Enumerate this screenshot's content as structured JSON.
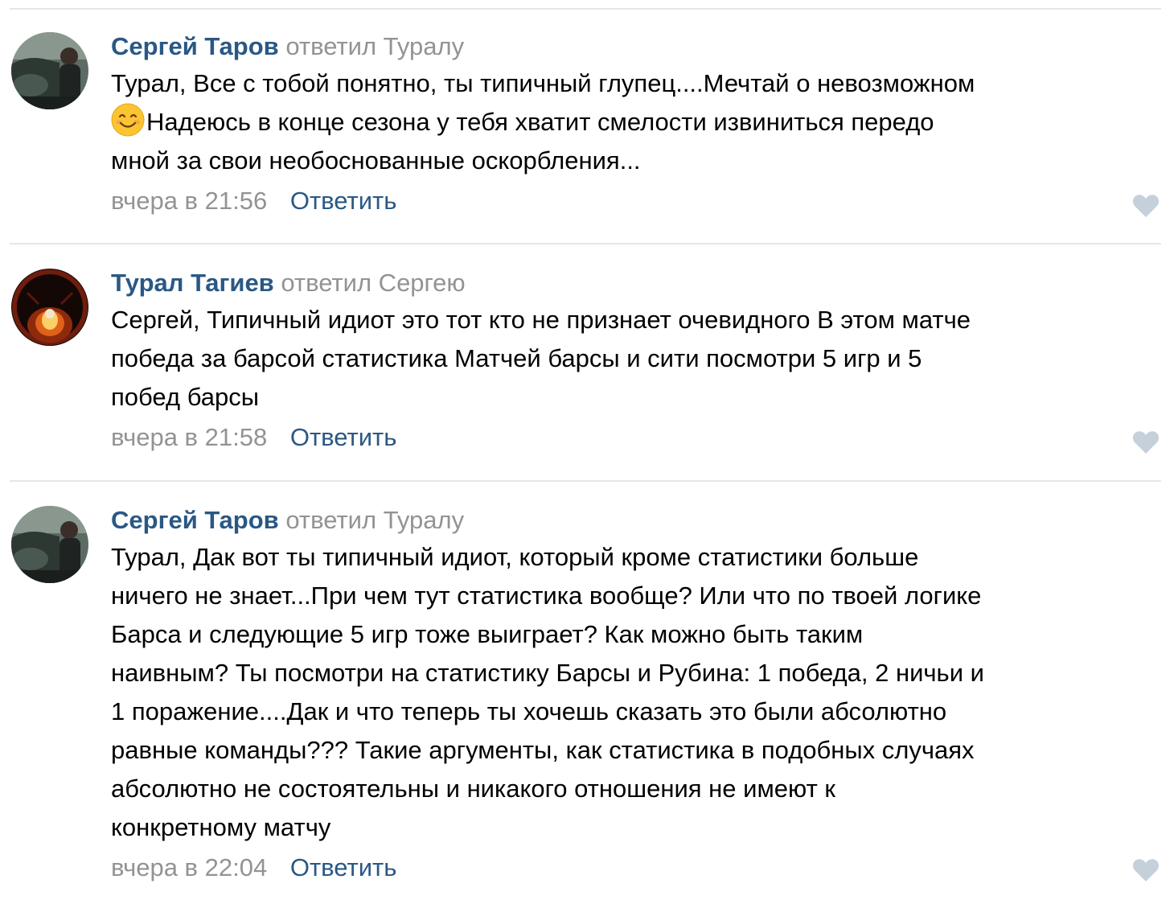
{
  "comments": [
    {
      "author": "Сергей Таров",
      "replied_to": "ответил Туралу",
      "text_lines": [
        "Турал, Все с тобой понятно, ты типичный глупец....Мечтай о невозможном",
        "Надеюсь в конце сезона у тебя хватит смелости извиниться передо",
        "мной за свои необоснованные оскорбления..."
      ],
      "time": "вчера в 21:56",
      "reply_label": "Ответить",
      "avatar_icon": "avatar-photo-car"
    },
    {
      "author": "Турал Тагиев",
      "replied_to": "ответил Сергею",
      "text_lines": [
        "Сергей, Типичный идиот это тот кто не признает очевидного В этом матче",
        "победа за барсой статистика Матчей барсы и сити посмотри 5 игр и 5",
        "побед барсы"
      ],
      "time": "вчера в 21:58",
      "reply_label": "Ответить",
      "avatar_icon": "avatar-photo-fire"
    },
    {
      "author": "Сергей Таров",
      "replied_to": "ответил Туралу",
      "text_lines": [
        "Турал, Дак вот ты типичный идиот, который кроме статистики больше",
        "ничего не знает...При чем тут статистика вообще? Или что по твоей логике",
        "Барса и следующие 5 игр тоже выиграет? Как можно быть таким",
        "наивным? Ты посмотри на статистику Барсы и Рубина: 1 победа, 2 ничьи и",
        "1 поражение....Дак и что теперь ты хочешь сказать это были абсолютно",
        "равные команды??? Такие аргументы, как статистика в подобных случаях",
        "абсолютно не состоятельны и никакого отношения не имеют к",
        "конкретному матчу"
      ],
      "time": "вчера в 22:04",
      "reply_label": "Ответить",
      "avatar_icon": "avatar-photo-car"
    }
  ],
  "icons": {
    "like": "heart-icon",
    "emoji": "smiling-face-emoji"
  },
  "colors": {
    "link": "#2a5885",
    "muted": "#939393",
    "text": "#000000",
    "divider": "#e4e6ea",
    "heart": "#c5d0db"
  }
}
